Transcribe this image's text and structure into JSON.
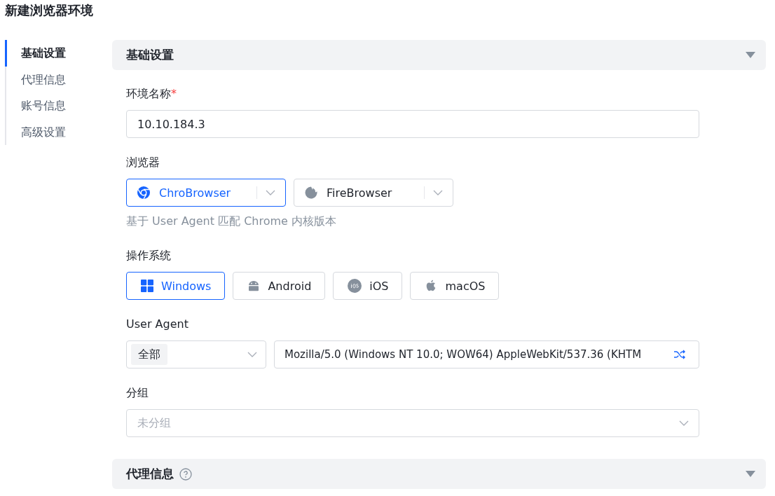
{
  "page_title": "新建浏览器环境",
  "nav": [
    {
      "label": "基础设置",
      "selected": true
    },
    {
      "label": "代理信息",
      "selected": false
    },
    {
      "label": "账号信息",
      "selected": false
    },
    {
      "label": "高级设置",
      "selected": false
    }
  ],
  "sections": [
    {
      "title": "基础设置",
      "help": false,
      "expanded": true
    },
    {
      "title": "代理信息",
      "help": true,
      "expanded": true
    }
  ],
  "name_field": {
    "label": "环境名称",
    "required_mark": "*",
    "value": "10.10.184.3"
  },
  "browser": {
    "label": "浏览器",
    "options": [
      {
        "kind": "chrome",
        "name": "ChroBrowser",
        "selected": true
      },
      {
        "kind": "firefox",
        "name": "FireBrowser",
        "selected": false
      }
    ],
    "hint": "基于 User Agent 匹配 Chrome 内核版本"
  },
  "os": {
    "label": "操作系统",
    "options": [
      {
        "kind": "windows",
        "name": "Windows",
        "selected": true
      },
      {
        "kind": "android",
        "name": "Android",
        "selected": false
      },
      {
        "kind": "ios",
        "name": "iOS",
        "selected": false
      },
      {
        "kind": "macos",
        "name": "macOS",
        "selected": false
      }
    ]
  },
  "user_agent": {
    "label": "User Agent",
    "filter": "全部",
    "value": "Mozilla/5.0 (Windows NT 10.0; WOW64) AppleWebKit/537.36 (KHTM"
  },
  "group": {
    "label": "分组",
    "placeholder": "未分组"
  }
}
